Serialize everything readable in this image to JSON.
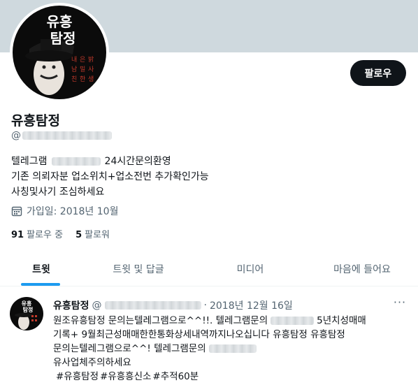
{
  "profile": {
    "display_name": "유흥탐정",
    "handle_prefix": "@",
    "avatar_text_top": "유흥",
    "avatar_text_bottom": "탐정",
    "follow_label": "팔로우"
  },
  "bio": {
    "line1_pre": "텔레그램",
    "line1_post": "24시간문의환영",
    "line2": "기존 의뢰자분 업소위치+업소전번 추가확인가능",
    "line3": "사칭및사기 조심하세요"
  },
  "joined": "가입일: 2018년 10월",
  "stats": {
    "following_count": "91",
    "following_label": "팔로우 중",
    "followers_count": "5",
    "followers_label": "팔로워"
  },
  "tabs": [
    {
      "label": "트윗"
    },
    {
      "label": "트윗 및 답글"
    },
    {
      "label": "미디어"
    },
    {
      "label": "마음에 들어요"
    }
  ],
  "tweet": {
    "name": "유흥탐정",
    "handle_prefix": "@",
    "date_sep": "·",
    "date": "2018년 12월 16일",
    "more": "···",
    "line1_pre": "원조유흥탐정 문의는텔레그램으로^^!!. 텔레그램문의",
    "line1_post": "5년치성매매",
    "line2": "기록+ 9월최근성매매한한통화상세내역까지나오십니다 유흥탐정 유흥탐정",
    "line3_pre": "문의는텔레그램으로^^! 텔레그램문의",
    "line4": "유사업체주의하세요",
    "hashtags": [
      "#유흥탐정",
      "#유흥흥신소",
      "#추적60분"
    ]
  },
  "colors": {
    "banner": "#cfd9de",
    "accent": "#1d9bf0",
    "text": "#0f1419",
    "muted": "#536471"
  }
}
